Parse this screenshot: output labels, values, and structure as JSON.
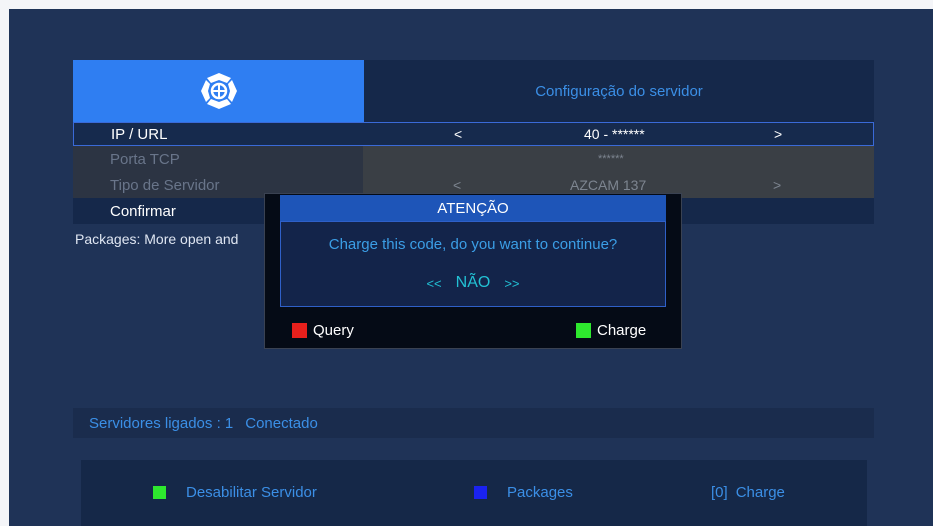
{
  "header": {
    "title": "Configuração do servidor",
    "logo_icon": "satellite-logo-icon"
  },
  "rows": {
    "ip": {
      "label": "IP / URL",
      "left_arrow": "<",
      "value": "40 - ******",
      "right_arrow": ">"
    },
    "porta": {
      "label": "Porta TCP",
      "value": "******"
    },
    "tipo": {
      "label": "Tipo de Servidor",
      "left_arrow": "<",
      "value": "AZCAM 137",
      "right_arrow": ">"
    },
    "confirm": {
      "label": "Confirmar"
    }
  },
  "packages_text": "Packages: More open and",
  "status": {
    "label": "Servidores ligados : 1",
    "state": "Conectado"
  },
  "footer": {
    "green_label": "Desabilitar Servidor",
    "blue_label": "Packages",
    "charge_key": "[0]",
    "charge_label": "Charge"
  },
  "dialog": {
    "title": "ATENÇÃO",
    "message": "Charge this code, do you want to continue?",
    "choice_left": "<<",
    "choice": "NÃO",
    "choice_right": ">>",
    "red_label": "Query",
    "green_label": "Charge"
  },
  "colors": {
    "background": "#1f3357",
    "accent": "#2f7ef2",
    "text_blue": "#3b8fe6",
    "red_key": "#e8201c",
    "green_key": "#2ee82e",
    "blue_key": "#1a22f0"
  }
}
